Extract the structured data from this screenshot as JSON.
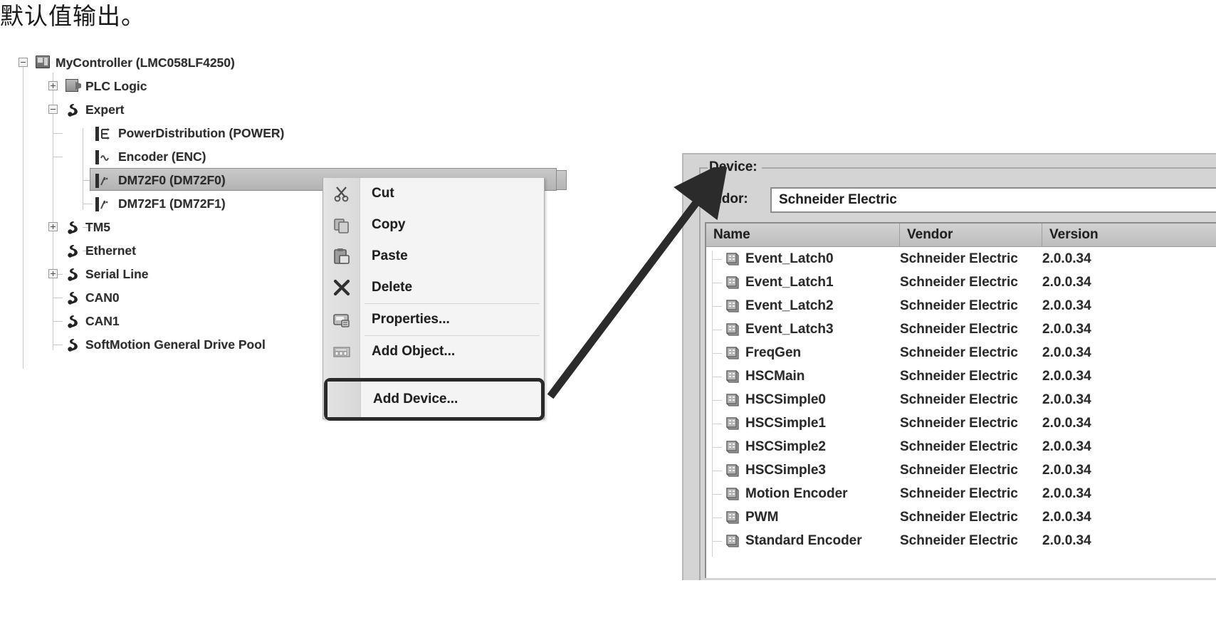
{
  "caption": "默认值输出。",
  "tree": {
    "nodes": [
      {
        "label": "MyController (LMC058LF4250)",
        "depth": 0,
        "expander": "minus",
        "icon": "controller-icon",
        "selected": false
      },
      {
        "label": "PLC Logic",
        "depth": 1,
        "expander": "plus",
        "icon": "plc-logic-icon",
        "selected": false
      },
      {
        "label": "Expert",
        "depth": 1,
        "expander": "minus",
        "icon": "node-icon",
        "selected": false
      },
      {
        "label": "PowerDistribution (POWER)",
        "depth": 2,
        "expander": "none",
        "icon": "power-distribution-icon",
        "selected": false
      },
      {
        "label": "Encoder (ENC)",
        "depth": 2,
        "expander": "none",
        "icon": "encoder-icon",
        "selected": false
      },
      {
        "label": "DM72F0 (DM72F0)",
        "depth": 2,
        "expander": "none",
        "icon": "module-icon",
        "selected": true
      },
      {
        "label": "DM72F1 (DM72F1)",
        "depth": 2,
        "expander": "none",
        "icon": "module-icon",
        "selected": false
      },
      {
        "label": "TM5",
        "depth": 1,
        "expander": "plus",
        "icon": "node-icon",
        "selected": false
      },
      {
        "label": "Ethernet",
        "depth": 1,
        "expander": "none",
        "icon": "node-icon",
        "selected": false
      },
      {
        "label": "Serial Line",
        "depth": 1,
        "expander": "plus",
        "icon": "node-icon",
        "selected": false
      },
      {
        "label": "CAN0",
        "depth": 1,
        "expander": "none",
        "icon": "node-icon",
        "selected": false
      },
      {
        "label": "CAN1",
        "depth": 1,
        "expander": "none",
        "icon": "node-icon",
        "selected": false
      },
      {
        "label": "SoftMotion General Drive Pool",
        "depth": 1,
        "expander": "none",
        "icon": "node-icon",
        "selected": false
      }
    ]
  },
  "context_menu": {
    "items": [
      {
        "label": "Cut",
        "icon": "scissors-icon",
        "separator_after": false
      },
      {
        "label": "Copy",
        "icon": "copy-icon",
        "separator_after": false
      },
      {
        "label": "Paste",
        "icon": "paste-icon",
        "separator_after": false
      },
      {
        "label": "Delete",
        "icon": "x-delete-icon",
        "separator_after": true
      },
      {
        "label": "Properties...",
        "icon": "properties-icon",
        "separator_after": true
      },
      {
        "label": "Add Object...",
        "icon": "add-object-icon",
        "separator_after": false
      }
    ],
    "highlighted_item": {
      "label": "Add Device...",
      "icon": "add-device-icon"
    }
  },
  "device_dialog": {
    "group_label": "Device:",
    "vendor_label": "Vendor:",
    "vendor_value": "Schneider Electric",
    "columns": [
      "Name",
      "Vendor",
      "Version"
    ],
    "rows": [
      {
        "name": "Event_Latch0",
        "vendor": "Schneider Electric",
        "version": "2.0.0.34"
      },
      {
        "name": "Event_Latch1",
        "vendor": "Schneider Electric",
        "version": "2.0.0.34"
      },
      {
        "name": "Event_Latch2",
        "vendor": "Schneider Electric",
        "version": "2.0.0.34"
      },
      {
        "name": "Event_Latch3",
        "vendor": "Schneider Electric",
        "version": "2.0.0.34"
      },
      {
        "name": "FreqGen",
        "vendor": "Schneider Electric",
        "version": "2.0.0.34"
      },
      {
        "name": "HSCMain",
        "vendor": "Schneider Electric",
        "version": "2.0.0.34"
      },
      {
        "name": "HSCSimple0",
        "vendor": "Schneider Electric",
        "version": "2.0.0.34"
      },
      {
        "name": "HSCSimple1",
        "vendor": "Schneider Electric",
        "version": "2.0.0.34"
      },
      {
        "name": "HSCSimple2",
        "vendor": "Schneider Electric",
        "version": "2.0.0.34"
      },
      {
        "name": "HSCSimple3",
        "vendor": "Schneider Electric",
        "version": "2.0.0.34"
      },
      {
        "name": "Motion Encoder",
        "vendor": "Schneider Electric",
        "version": "2.0.0.34"
      },
      {
        "name": "PWM",
        "vendor": "Schneider Electric",
        "version": "2.0.0.34"
      },
      {
        "name": "Standard Encoder",
        "vendor": "Schneider Electric",
        "version": "2.0.0.34"
      }
    ]
  },
  "annotation": {
    "arrow": "callout-arrow"
  },
  "colors": {
    "dialog_face": "#d4d4d4",
    "selection": "#c2c2c2",
    "highlight_border": "#2a2a2a",
    "text": "#1f1f1f"
  }
}
